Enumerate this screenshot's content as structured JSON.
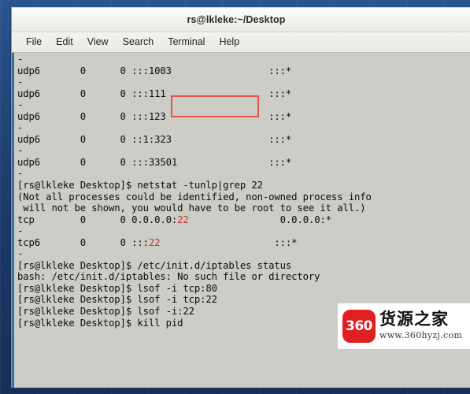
{
  "window": {
    "title": "rs@lkleke:~/Desktop"
  },
  "menu": {
    "items": [
      {
        "label": "File"
      },
      {
        "label": "Edit"
      },
      {
        "label": "View"
      },
      {
        "label": "Search"
      },
      {
        "label": "Terminal"
      },
      {
        "label": "Help"
      }
    ]
  },
  "terminal": {
    "lines": [
      {
        "text": "-"
      },
      {
        "text": "udp6       0      0 :::1003                 :::*"
      },
      {
        "text": "-"
      },
      {
        "text": "udp6       0      0 :::111                  :::*"
      },
      {
        "text": "-"
      },
      {
        "text": "udp6       0      0 :::123                  :::*"
      },
      {
        "text": "-"
      },
      {
        "text": "udp6       0      0 ::1:323                 :::*"
      },
      {
        "text": "-"
      },
      {
        "text": "udp6       0      0 :::33501                :::*"
      },
      {
        "text": "-"
      },
      {
        "text": "[rs@lkleke Desktop]$ netstat -tunlp|grep 22"
      },
      {
        "text": "(Not all processes could be identified, non-owned process info"
      },
      {
        "text": " will not be shown, you would have to be root to see it all.)"
      },
      {
        "pre": "tcp        0      0 0.0.0.0:",
        "hit": "22",
        "post": "                0.0.0.0:*"
      },
      {
        "text": "-"
      },
      {
        "pre": "tcp6       0      0 :::",
        "hit": "22",
        "post": "                    :::*"
      },
      {
        "text": "-"
      },
      {
        "text": "[rs@lkleke Desktop]$ /etc/init.d/iptables status"
      },
      {
        "text": "bash: /etc/init.d/iptables: No such file or directory"
      },
      {
        "text": "[rs@lkleke Desktop]$ lsof -i tcp:80"
      },
      {
        "text": "[rs@lkleke Desktop]$ lsof -i tcp:22"
      },
      {
        "text": "[rs@lkleke Desktop]$ lsof -i:22"
      },
      {
        "text": "[rs@lkleke Desktop]$ kill pid"
      }
    ]
  },
  "annotation": {
    "shape": "rectangle",
    "color": "#e8534a",
    "targets": "kill pid"
  },
  "watermark": {
    "badge_text": "360",
    "brand_text": "货源之家",
    "url_text": "www.360hyzj.com",
    "badge_color": "#e02020"
  }
}
